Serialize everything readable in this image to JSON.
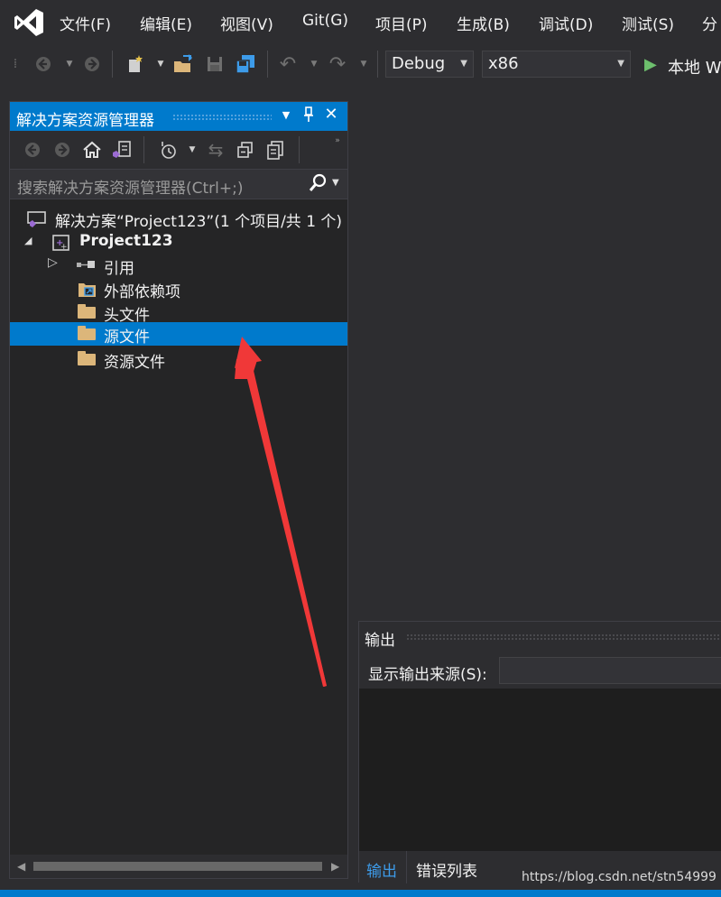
{
  "menu": {
    "items": [
      "文件(F)",
      "编辑(E)",
      "视图(V)",
      "Git(G)",
      "项目(P)",
      "生成(B)",
      "调试(D)",
      "测试(S)",
      "分"
    ]
  },
  "toolbar": {
    "config_combo": "Debug",
    "platform_combo": "x86",
    "run_label": "本地 W"
  },
  "solution_explorer": {
    "title": "解决方案资源管理器",
    "search_placeholder": "搜索解决方案资源管理器(Ctrl+;)",
    "tree": [
      {
        "label": "解决方案“Project123”(1 个项目/共 1 个)",
        "level": 0
      },
      {
        "label": "Project123",
        "level": 1
      },
      {
        "label": "引用",
        "level": 2
      },
      {
        "label": "外部依赖项",
        "level": 2
      },
      {
        "label": "头文件",
        "level": 2
      },
      {
        "label": "源文件",
        "level": 2
      },
      {
        "label": "资源文件",
        "level": 2
      }
    ]
  },
  "output": {
    "title": "输出",
    "source_label": "显示输出来源(S):",
    "tabs": [
      "输出",
      "错误列表"
    ]
  },
  "watermark": "https://blog.csdn.net/stn54999",
  "colors": {
    "accent": "#007acc",
    "background": "#2d2d30",
    "panel": "#252526",
    "annotation_arrow": "#f03838"
  }
}
